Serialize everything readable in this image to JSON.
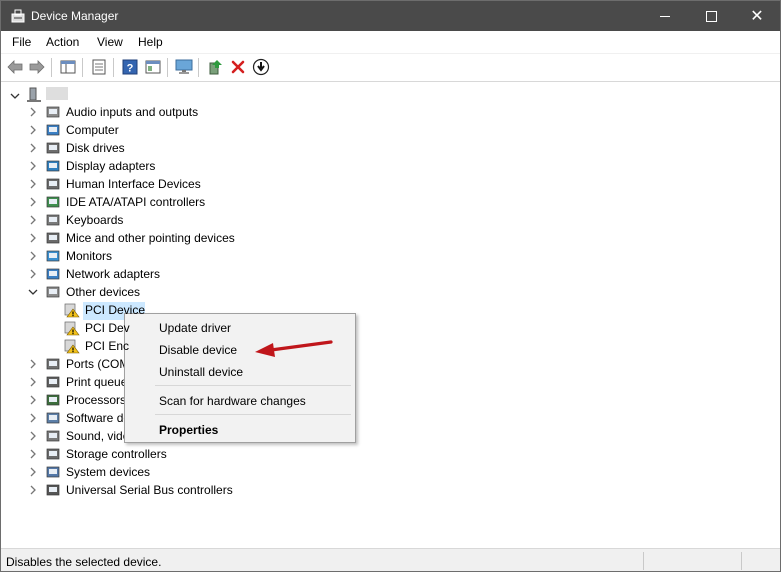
{
  "window": {
    "title": "Device Manager"
  },
  "menubar": {
    "items": [
      "File",
      "Action",
      "View",
      "Help"
    ]
  },
  "toolbar": {
    "icons": [
      "back-arrow-icon",
      "forward-arrow-icon",
      "show-hide-tree-icon",
      "properties-icon",
      "help-icon",
      "view-icon",
      "scan-hardware-icon",
      "update-driver-icon",
      "uninstall-icon",
      "disable-icon"
    ]
  },
  "tree": {
    "root_label": "",
    "categories": [
      "Audio inputs and outputs",
      "Computer",
      "Disk drives",
      "Display adapters",
      "Human Interface Devices",
      "IDE ATA/ATAPI controllers",
      "Keyboards",
      "Mice and other pointing devices",
      "Monitors",
      "Network adapters",
      "Other devices",
      "Ports (COM",
      "Print queue",
      "Processors",
      "Software de",
      "Sound, vide",
      "Storage controllers",
      "System devices",
      "Universal Serial Bus controllers"
    ],
    "other_devices_children": [
      "PCI Device",
      "PCI Dev",
      "PCI Enc"
    ]
  },
  "context_menu": {
    "update": "Update driver",
    "disable": "Disable device",
    "uninstall": "Uninstall device",
    "scan": "Scan for hardware changes",
    "properties": "Properties"
  },
  "statusbar": {
    "text": "Disables the selected device."
  },
  "colors": {
    "titlebar": "#4a4a4a",
    "selection": "#cce8ff",
    "arrow": "#c0161b",
    "menu_bg": "#f2f2f2"
  }
}
